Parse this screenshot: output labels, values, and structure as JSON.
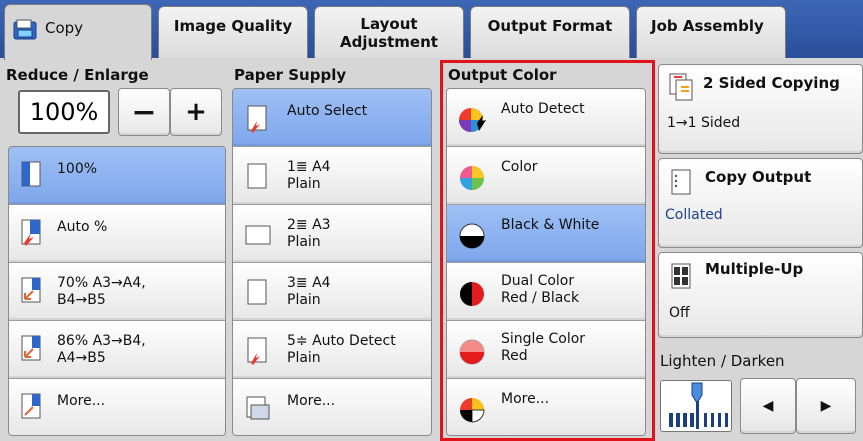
{
  "tabs": {
    "copy": "Copy",
    "image_quality": "Image Quality",
    "layout_line1": "Layout",
    "layout_line2": "Adjustment",
    "output_format": "Output Format",
    "job_assembly": "Job Assembly"
  },
  "reduce_enlarge": {
    "label": "Reduce / Enlarge",
    "value": "100%",
    "minus": "−",
    "plus": "+",
    "options": [
      {
        "line1": "100%",
        "line2": ""
      },
      {
        "line1": "Auto %",
        "line2": ""
      },
      {
        "line1": "70% A3→A4,",
        "line2": "B4→B5"
      },
      {
        "line1": "86% A3→B4,",
        "line2": "A4→B5"
      },
      {
        "line1": "More...",
        "line2": ""
      }
    ]
  },
  "paper_supply": {
    "label": "Paper Supply",
    "options": [
      {
        "line1": "Auto Select",
        "line2": ""
      },
      {
        "line1": "1≣ A4",
        "line2": "Plain"
      },
      {
        "line1": "2≣ A3",
        "line2": "Plain"
      },
      {
        "line1": "3≣ A4",
        "line2": "Plain"
      },
      {
        "line1": "5≑ Auto Detect",
        "line2": "Plain"
      },
      {
        "line1": "More...",
        "line2": ""
      }
    ]
  },
  "output_color": {
    "label": "Output Color",
    "options": [
      {
        "line1": "Auto Detect",
        "line2": ""
      },
      {
        "line1": "Color",
        "line2": ""
      },
      {
        "line1": "Black & White",
        "line2": ""
      },
      {
        "line1": "Dual Color",
        "line2": "Red / Black"
      },
      {
        "line1": "Single Color",
        "line2": "Red"
      },
      {
        "line1": "More...",
        "line2": ""
      }
    ]
  },
  "two_sided": {
    "title": "2 Sided Copying",
    "value": "1→1 Sided"
  },
  "copy_output": {
    "title": "Copy Output",
    "value": "Collated"
  },
  "multiple_up": {
    "title": "Multiple-Up",
    "value": "Off"
  },
  "lighten_darken": {
    "label": "Lighten / Darken",
    "left": "◀",
    "right": "▶"
  },
  "colors": {
    "accent": "#2a4f9a",
    "selected": "#8fb3f0",
    "highlight_frame": "#e0121b"
  }
}
